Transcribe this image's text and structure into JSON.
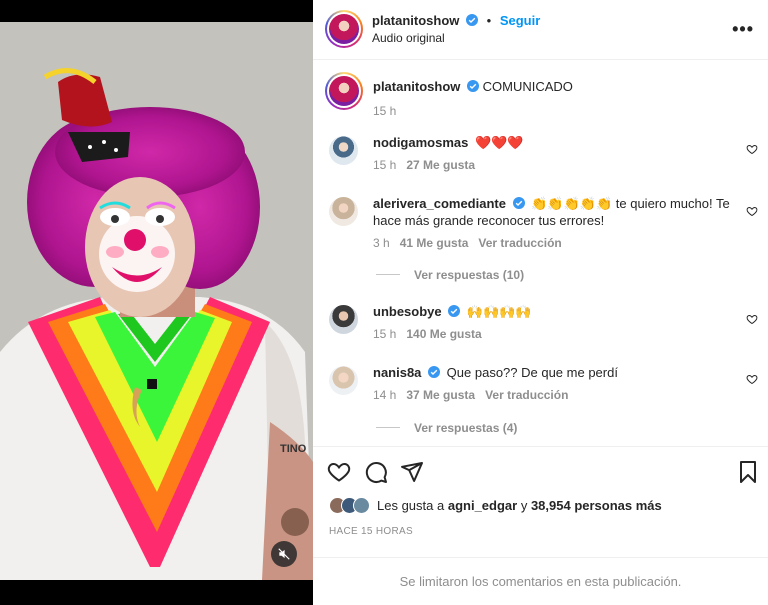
{
  "header": {
    "username": "platanitoshow",
    "follow_label": "Seguir",
    "dot": "•",
    "audio": "Audio original",
    "more": "•••"
  },
  "caption": {
    "username": "platanitoshow",
    "text": "COMUNICADO",
    "time": "15 h"
  },
  "comments": [
    {
      "username": "nodigamosmas",
      "verified": false,
      "text": "❤️❤️❤️",
      "time": "15 h",
      "likes": "27 Me gusta",
      "translate": ""
    },
    {
      "username": "alerivera_comediante",
      "verified": true,
      "text": "👏👏👏👏👏 te quiero mucho! Te hace más grande reconocer tus errores!",
      "time": "3 h",
      "likes": "41 Me gusta",
      "translate": "Ver traducción",
      "replies": "Ver respuestas (10)"
    },
    {
      "username": "unbesobye",
      "verified": true,
      "text": "🙌🙌🙌🙌",
      "time": "15 h",
      "likes": "140 Me gusta",
      "translate": ""
    },
    {
      "username": "nanis8a",
      "verified": true,
      "text": "Que paso?? De que me perdí",
      "time": "14 h",
      "likes": "37 Me gusta",
      "translate": "Ver traducción",
      "replies": "Ver respuestas (4)"
    }
  ],
  "actions": {
    "likes_prefix": "Les gusta a",
    "liker": "agni_edgar",
    "likes_mid": "y",
    "likes_count": "38,954 personas más",
    "timestamp": "HACE 15 HORAS"
  },
  "footer": {
    "notice": "Se limitaron los comentarios en esta publicación."
  },
  "media": {
    "tattoo_text": "TINO"
  },
  "colors": {
    "accent": "#0095f6",
    "verified": "#3897f0",
    "muted": "#8e8e8e",
    "like_heart": "#ed4956"
  }
}
